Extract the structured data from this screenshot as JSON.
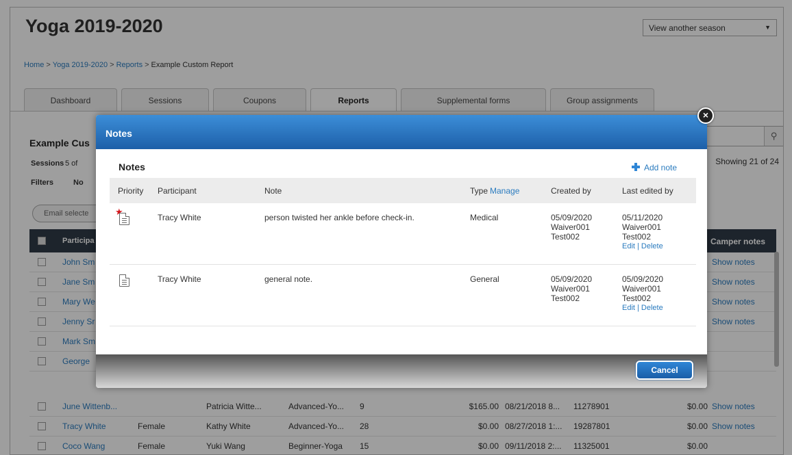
{
  "page": {
    "title": "Yoga 2019-2020",
    "season_select": "View another season",
    "breadcrumb": [
      {
        "label": "Home"
      },
      {
        "label": "Yoga 2019-2020"
      },
      {
        "label": "Reports"
      },
      {
        "label": "Example Custom Report"
      }
    ],
    "breadcrumb_separator": ">",
    "tabs": [
      {
        "label": "Dashboard"
      },
      {
        "label": "Sessions"
      },
      {
        "label": "Coupons"
      },
      {
        "label": "Reports",
        "active": true
      },
      {
        "label": "Supplemental forms"
      },
      {
        "label": "Group assignments"
      }
    ],
    "report_title": "Example Cus",
    "sessions_label": "Sessions",
    "sessions_value": "5 of",
    "filters_label": "Filters",
    "filters_value": "No",
    "showing": "Showing 21 of 24",
    "email_button": "Email selecte",
    "table": {
      "header_participant": "Participa",
      "header_camper_notes": "Camper notes",
      "rows": [
        {
          "participant": "John Sm",
          "camper_notes": "Show notes"
        },
        {
          "participant": "Jane Sm",
          "camper_notes": "Show notes"
        },
        {
          "participant": "Mary We",
          "camper_notes": "Show notes"
        },
        {
          "participant": "Jenny Sr",
          "camper_notes": "Show notes"
        },
        {
          "participant": "Mark Sm",
          "camper_notes": ""
        },
        {
          "participant": "George",
          "camper_notes": ""
        },
        {
          "participant": "June Wittenb...",
          "gender": "",
          "parent": "Patricia Witte...",
          "session": "Advanced-Yo...",
          "age": "9",
          "paid": "$165.00",
          "date": "08/21/2018 8...",
          "id": "11278901",
          "balance": "$0.00",
          "camper_notes": "Show notes"
        },
        {
          "participant": "Tracy White",
          "gender": "Female",
          "parent": "Kathy White",
          "session": "Advanced-Yo...",
          "age": "28",
          "paid": "$0.00",
          "date": "08/27/2018 1:...",
          "id": "19287801",
          "balance": "$0.00",
          "camper_notes": "Show notes"
        },
        {
          "participant": "Coco Wang",
          "gender": "Female",
          "parent": "Yuki Wang",
          "session": "Beginner-Yoga",
          "age": "15",
          "paid": "$0.00",
          "date": "09/11/2018 2:...",
          "id": "11325001",
          "balance": "$0.00",
          "camper_notes": ""
        }
      ]
    }
  },
  "modal": {
    "title": "Notes",
    "heading": "Notes",
    "add_note": "Add note",
    "columns": {
      "priority": "Priority",
      "participant": "Participant",
      "note": "Note",
      "type": "Type",
      "manage": "Manage",
      "created_by": "Created by",
      "last_edited_by": "Last edited by"
    },
    "notes": [
      {
        "priority_flag": true,
        "participant": "Tracy White",
        "note": "person twisted her ankle before check-in.",
        "type": "Medical",
        "created_date": "05/09/2020",
        "created_user": "Waiver001",
        "created_org": "Test002",
        "edited_date": "05/11/2020",
        "edited_user": "Waiver001",
        "edited_org": "Test002",
        "actions": "Edit | Delete"
      },
      {
        "priority_flag": false,
        "participant": "Tracy White",
        "note": "general note.",
        "type": "General",
        "created_date": "05/09/2020",
        "created_user": "Waiver001",
        "created_org": "Test002",
        "edited_date": "05/09/2020",
        "edited_user": "Waiver001",
        "edited_org": "Test002",
        "actions": "Edit | Delete"
      }
    ],
    "cancel_button": "Cancel",
    "close_icon": "×"
  },
  "colors": {
    "header_blue": "#2a6fc0",
    "link_blue": "#2a7bbf",
    "priority_red": "#d4151b",
    "table_header_dark": "#2f3b48"
  }
}
